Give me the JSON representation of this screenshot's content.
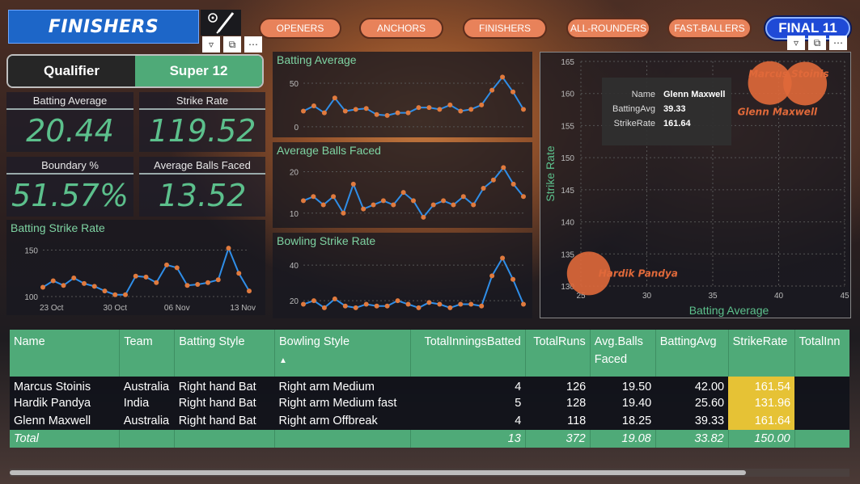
{
  "header": {
    "title": "FINISHERS",
    "nav": [
      "OPENERS",
      "ANCHORS",
      "FINISHERS",
      "ALL-ROUNDERS",
      "FAST-BALLERS"
    ],
    "final_label": "FINAL 11"
  },
  "toggle": {
    "options": [
      "Qualifier",
      "Super 12"
    ],
    "selected": "Super 12"
  },
  "kpis": [
    {
      "label": "Batting Average",
      "value": "20.44"
    },
    {
      "label": "Strike Rate",
      "value": "119.52"
    },
    {
      "label": "Boundary %",
      "value": "51.57%"
    },
    {
      "label": "Average Balls Faced",
      "value": "13.52"
    }
  ],
  "colors": {
    "accent_green": "#4faa78",
    "value_green": "#5cc08c",
    "line_blue": "#2f8ee8",
    "point_orange": "#e07a3e",
    "highlight_yellow": "#e6c235",
    "bubble_orange": "#e0693a"
  },
  "chart_data": [
    {
      "type": "line",
      "title": "Batting Strike Rate",
      "x_ticks": [
        "23 Oct",
        "30 Oct",
        "06 Nov",
        "13 Nov"
      ],
      "y_ticks": [
        100,
        150
      ],
      "values": [
        110,
        117,
        112,
        120,
        114,
        111,
        106,
        102,
        102,
        122,
        121,
        115,
        134,
        131,
        112,
        113,
        115,
        118,
        152,
        125,
        106
      ]
    },
    {
      "type": "line",
      "title": "Batting Average",
      "y_ticks": [
        0,
        50
      ],
      "values": [
        18,
        24,
        16,
        33,
        18,
        20,
        21,
        14,
        13,
        16,
        16,
        22,
        22,
        20,
        25,
        18,
        20,
        25,
        42,
        57,
        40,
        20
      ]
    },
    {
      "type": "line",
      "title": "Average Balls Faced",
      "y_ticks": [
        10,
        20
      ],
      "values": [
        13,
        14,
        12,
        14,
        10,
        17,
        11,
        12,
        13,
        12,
        15,
        13,
        9,
        12,
        13,
        12,
        14,
        12,
        16,
        18,
        21,
        17,
        14
      ]
    },
    {
      "type": "line",
      "title": "Bowling Strike Rate",
      "y_ticks": [
        20,
        40
      ],
      "values": [
        18,
        20,
        16,
        21,
        17,
        16,
        18,
        17,
        17,
        20,
        18,
        16,
        19,
        18,
        16,
        18,
        18,
        17,
        34,
        44,
        32,
        18
      ]
    },
    {
      "type": "scatter",
      "xlabel": "Batting Average",
      "ylabel": "Strike Rate",
      "xlim": [
        25,
        45
      ],
      "ylim": [
        130,
        165
      ],
      "x_ticks": [
        25,
        30,
        35,
        40,
        45
      ],
      "y_ticks": [
        130,
        135,
        140,
        145,
        150,
        155,
        160,
        165
      ],
      "points": [
        {
          "name": "Marcus Stoinis",
          "x": 42.0,
          "y": 161.54
        },
        {
          "name": "Glenn Maxwell",
          "x": 39.33,
          "y": 161.64
        },
        {
          "name": "Hardik Pandya",
          "x": 25.6,
          "y": 131.96
        }
      ],
      "point_labels": [
        "Marcus Stoinis",
        "Glenn Maxwell",
        "Hardik Pandya"
      ]
    }
  ],
  "tooltip": {
    "rows": [
      {
        "k": "Name",
        "v": "Glenn Maxwell"
      },
      {
        "k": "BattingAvg",
        "v": "39.33"
      },
      {
        "k": "StrikeRate",
        "v": "161.64"
      }
    ]
  },
  "table": {
    "columns": [
      "Name",
      "Team",
      "Batting Style",
      "Bowling Style",
      "TotalInningsBatted",
      "TotalRuns",
      "Avg.Balls Faced",
      "BattingAvg",
      "StrikeRate",
      "TotalInn"
    ],
    "rows": [
      [
        "Marcus Stoinis",
        "Australia",
        "Right hand Bat",
        "Right arm Medium",
        "4",
        "126",
        "19.50",
        "42.00",
        "161.54"
      ],
      [
        "Hardik Pandya",
        "India",
        "Right hand Bat",
        "Right arm Medium fast",
        "5",
        "128",
        "19.40",
        "25.60",
        "131.96"
      ],
      [
        "Glenn Maxwell",
        "Australia",
        "Right hand Bat",
        "Right arm Offbreak",
        "4",
        "118",
        "18.25",
        "39.33",
        "161.64"
      ]
    ],
    "total": [
      "Total",
      "",
      "",
      "",
      "13",
      "372",
      "19.08",
      "33.82",
      "150.00"
    ]
  },
  "sort_indicator": "▲"
}
